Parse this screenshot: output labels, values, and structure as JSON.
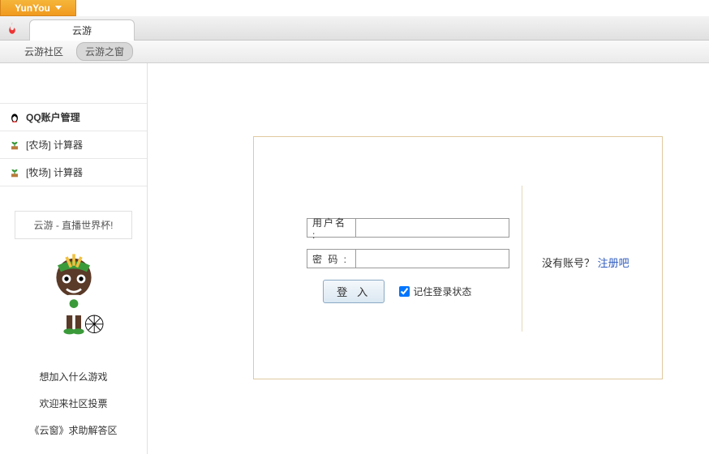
{
  "topbar": {
    "label": "YunYou"
  },
  "tab": {
    "label": "云游"
  },
  "subnav": {
    "community": "云游社区",
    "window": "云游之窗"
  },
  "sidebar": {
    "items": [
      {
        "label": "QQ账户管理"
      },
      {
        "label": "[农场] 计算器"
      },
      {
        "label": "[牧场] 计算器"
      }
    ],
    "promo": "云游 - 直播世界杯!",
    "links": [
      "想加入什么游戏",
      "欢迎来社区投票",
      "《云窗》求助解答区"
    ]
  },
  "login": {
    "username_label": "用户名   :",
    "password_label": "密   码   :",
    "submit": "登 入",
    "remember": "记住登录状态",
    "no_account": "没有账号？",
    "register": "注册吧"
  }
}
